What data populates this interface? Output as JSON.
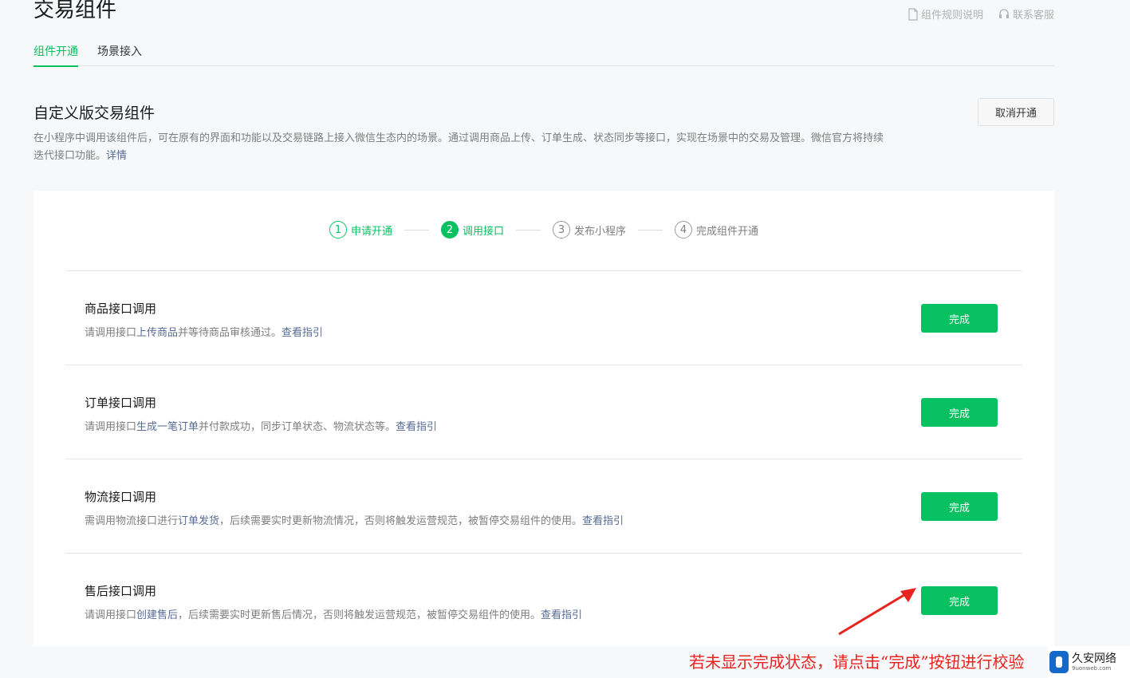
{
  "header": {
    "title": "交易组件",
    "links": [
      {
        "label": "组件规则说明",
        "icon": "document-icon"
      },
      {
        "label": "联系客服",
        "icon": "headset-icon"
      }
    ]
  },
  "tabs": [
    {
      "label": "组件开通",
      "active": true
    },
    {
      "label": "场景接入",
      "active": false
    }
  ],
  "section": {
    "title": "自定义版交易组件",
    "cancel_label": "取消开通",
    "description": "在小程序中调用该组件后，可在原有的界面和功能以及交易链路上接入微信生态内的场景。通过调用商品上传、订单生成、状态同步等接口，实现在场景中的交易及管理。微信官方将持续迭代接口功能。",
    "detail_link": "详情"
  },
  "steps": [
    {
      "num": "1",
      "label": "申请开通",
      "state": "done"
    },
    {
      "num": "2",
      "label": "调用接口",
      "state": "current"
    },
    {
      "num": "3",
      "label": "发布小程序",
      "state": "pending"
    },
    {
      "num": "4",
      "label": "完成组件开通",
      "state": "pending"
    }
  ],
  "tasks": [
    {
      "title": "商品接口调用",
      "pre": "请调用接口",
      "highlight": "上传商品",
      "post": "并等待商品审核通过。",
      "guide": "查看指引",
      "button": "完成"
    },
    {
      "title": "订单接口调用",
      "pre": "请调用接口",
      "highlight": "生成一笔订单",
      "post": "并付款成功，同步订单状态、物流状态等。",
      "guide": "查看指引",
      "button": "完成"
    },
    {
      "title": "物流接口调用",
      "pre": "需调用物流接口进行",
      "highlight": "订单发货",
      "post": "，后续需要实时更新物流情况，否则将触发运营规范，被暂停交易组件的使用。",
      "guide": "查看指引",
      "button": "完成"
    },
    {
      "title": "售后接口调用",
      "pre": "请调用接口",
      "highlight": "创建售后",
      "post": "，后续需要实时更新售后情况，否则将触发运营规范，被暂停交易组件的使用。",
      "guide": "查看指引",
      "button": "完成"
    }
  ],
  "annotation": {
    "text": "若未显示完成状态，请点击“完成”按钮进行校验",
    "color": "#e8231f"
  },
  "watermark": {
    "name": "久安网络",
    "url": "9uonweb.com"
  },
  "colors": {
    "accent": "#07c160",
    "link": "#576b95"
  }
}
